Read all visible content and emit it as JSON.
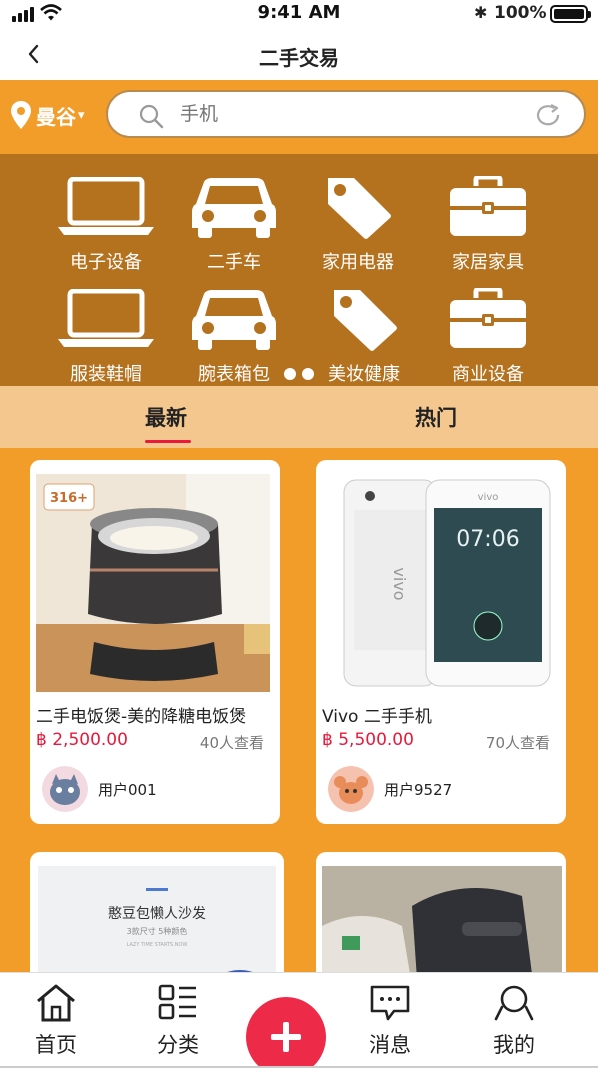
{
  "status_bar": {
    "time": "9:41 AM",
    "battery": "100%"
  },
  "nav": {
    "title": "二手交易"
  },
  "location": {
    "label": "曼谷"
  },
  "search": {
    "placeholder": "手机"
  },
  "categories": [
    {
      "label": "电子设备",
      "icon": "laptop-icon"
    },
    {
      "label": "二手车",
      "icon": "car-icon"
    },
    {
      "label": "家用电器",
      "icon": "tag-icon"
    },
    {
      "label": "家居家具",
      "icon": "briefcase-icon"
    },
    {
      "label": "服装鞋帽",
      "icon": "laptop-icon"
    },
    {
      "label": "腕表箱包",
      "icon": "car-icon"
    },
    {
      "label": "美妆健康",
      "icon": "tag-icon"
    },
    {
      "label": "商业设备",
      "icon": "briefcase-icon"
    }
  ],
  "tabs": [
    {
      "label": "最新",
      "active": true
    },
    {
      "label": "热门",
      "active": false
    }
  ],
  "products": [
    {
      "title": "二手电饭煲-美的降糖电饭煲",
      "price": "฿ 2,500.00",
      "views": "40人查看",
      "user": "用户001",
      "image_badge": "316+"
    },
    {
      "title": "Vivo 二手手机",
      "price": "฿ 5,500.00",
      "views": "70人查看",
      "user": "用户9527",
      "phone_time": "07:06",
      "phone_brand": "vivo"
    },
    {
      "image_heading": "憨豆包懒人沙发",
      "image_sub": "3款尺寸 5种颜色",
      "image_note": "LAZY TIME STARTS NOW"
    },
    {}
  ],
  "tab_bar": [
    {
      "label": "首页",
      "icon": "home-icon"
    },
    {
      "label": "分类",
      "icon": "category-icon"
    },
    {
      "label": "",
      "icon": "plus-icon"
    },
    {
      "label": "消息",
      "icon": "message-icon"
    },
    {
      "label": "我的",
      "icon": "profile-icon"
    }
  ],
  "colors": {
    "accent": "#F29D2A",
    "category_bg": "#B4711E",
    "tab_bg": "#F4C78E",
    "price": "#e8193a"
  }
}
